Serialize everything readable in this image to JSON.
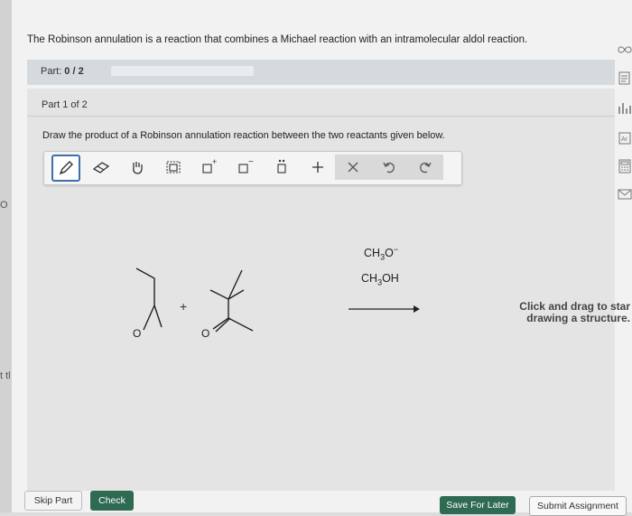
{
  "margin_text": {
    "circle": "O",
    "frag": "t tl"
  },
  "intro": "The Robinson annulation is a reaction that combines a Michael reaction with an intramolecular aldol reaction.",
  "part_bar": {
    "label_prefix": "Part:",
    "label_value": "0 / 2",
    "progress": 0.0
  },
  "panel": {
    "part_label": "Part 1 of 2",
    "instruction": "Draw the product of a Robinson annulation reaction between the two reactants given below."
  },
  "toolbar": {
    "tools": [
      "pencil-icon",
      "eraser-icon",
      "hand-icon",
      "selection-icon",
      "positive-charge-icon",
      "negative-charge-icon",
      "lone-pair-icon",
      "add-icon",
      "remove-icon",
      "undo-icon",
      "redo-icon"
    ]
  },
  "reaction": {
    "plus": "+",
    "atom_o1": "O",
    "atom_o2": "O",
    "reagent1": {
      "a": "CH",
      "sub": "3",
      "b": "O",
      "charge": "−"
    },
    "reagent2": {
      "a": "CH",
      "sub": "3",
      "b": "OH"
    }
  },
  "hint": {
    "line1": "Click and drag to star",
    "line2": "drawing a structure."
  },
  "buttons": {
    "skip": "Skip Part",
    "check": "Check",
    "save": "Save For Later",
    "submit": "Submit Assignment"
  },
  "side_icons": [
    "infinity-icon",
    "notes-icon",
    "chart-icon",
    "periodic-table-icon",
    "calculator-icon",
    "email-icon"
  ],
  "colors": {
    "accent": "#2f6a53",
    "selected_tool": "#3f6fa8"
  }
}
